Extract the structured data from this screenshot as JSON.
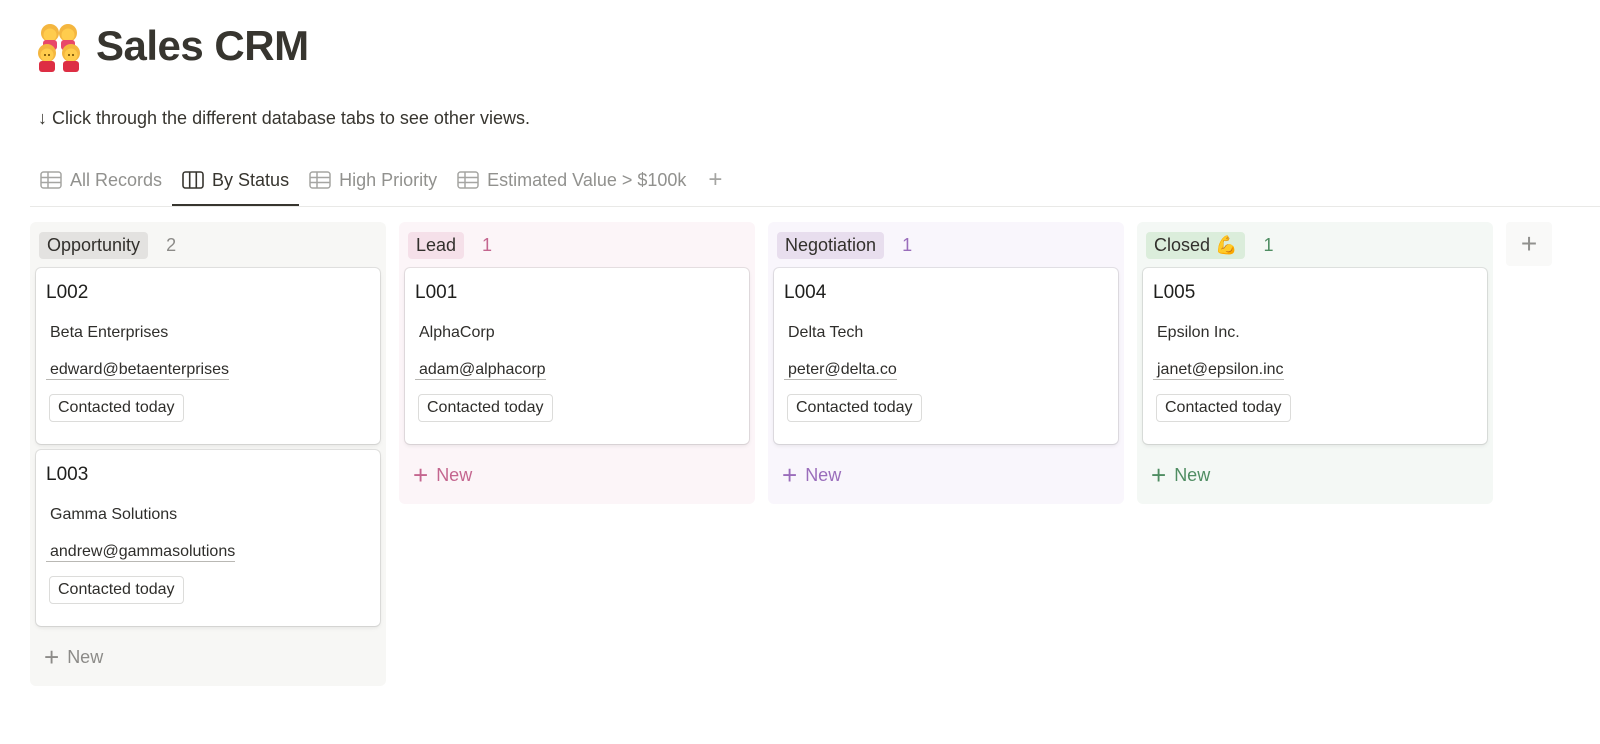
{
  "page": {
    "icon": "women-holding-hands-emoji",
    "title": "Sales CRM",
    "description": "↓ Click through the different database tabs to see other views."
  },
  "tabs": [
    {
      "label": "All Records",
      "icon": "table-icon",
      "active": false
    },
    {
      "label": "By Status",
      "icon": "board-icon",
      "active": true
    },
    {
      "label": "High Priority",
      "icon": "table-icon",
      "active": false
    },
    {
      "label": "Estimated Value > $100k",
      "icon": "table-icon",
      "active": false
    }
  ],
  "add_view_label": "+",
  "columns": [
    {
      "name": "Opportunity",
      "count": "2",
      "colors": {
        "bg": "#f7f7f5",
        "pill": "#e3e2e0",
        "accent": "#8c8b88"
      },
      "cards": [
        {
          "id": "L002",
          "company": "Beta Enterprises",
          "email": "edward@betaenterprises",
          "tag": "Contacted today"
        },
        {
          "id": "L003",
          "company": "Gamma Solutions",
          "email": "andrew@gammasolutions",
          "tag": "Contacted today"
        }
      ],
      "new_label": "New"
    },
    {
      "name": "Lead",
      "count": "1",
      "colors": {
        "bg": "#fcf5f8",
        "pill": "#f5e0e9",
        "accent": "#c4668f"
      },
      "cards": [
        {
          "id": "L001",
          "company": "AlphaCorp",
          "email": "adam@alphacorp",
          "tag": "Contacted today"
        }
      ],
      "new_label": "New"
    },
    {
      "name": "Negotiation",
      "count": "1",
      "colors": {
        "bg": "#f9f6fc",
        "pill": "#e8deee",
        "accent": "#9a6dbb"
      },
      "cards": [
        {
          "id": "L004",
          "company": "Delta Tech",
          "email": "peter@delta.co",
          "tag": "Contacted today"
        }
      ],
      "new_label": "New"
    },
    {
      "name": "Closed 💪",
      "count": "1",
      "colors": {
        "bg": "#f4f8f5",
        "pill": "#dbeddb",
        "accent": "#4f8d62"
      },
      "cards": [
        {
          "id": "L005",
          "company": "Epsilon Inc.",
          "email": "janet@epsilon.inc",
          "tag": "Contacted today"
        }
      ],
      "new_label": "New"
    }
  ],
  "add_group_label": "+"
}
